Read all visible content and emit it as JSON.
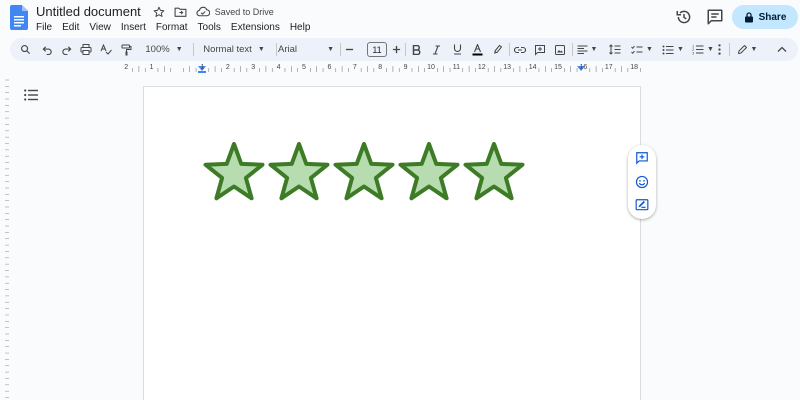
{
  "document": {
    "title": "Untitled document",
    "saved_status": "Saved to Drive"
  },
  "menu": [
    "File",
    "Edit",
    "View",
    "Insert",
    "Format",
    "Tools",
    "Extensions",
    "Help"
  ],
  "share": {
    "label": "Share"
  },
  "toolbar": {
    "zoom": "100%",
    "style": "Normal text",
    "font": "Arial",
    "font_size": "11",
    "text_color": "#000000"
  },
  "ruler": {
    "labels": [
      "2",
      "1",
      "1",
      "2",
      "3",
      "4",
      "5",
      "6",
      "7",
      "8",
      "9",
      "10",
      "11",
      "12",
      "13",
      "14",
      "15",
      "16",
      "17",
      "18"
    ]
  },
  "stars": {
    "count": 5,
    "fill": "#b7dcb0",
    "stroke": "#3e7b27"
  },
  "colors": {
    "accent": "#0b57d0",
    "share_bg": "#c2e7ff",
    "toolbar_bg": "#edf2fa",
    "app_bg": "#f9fbfd"
  }
}
